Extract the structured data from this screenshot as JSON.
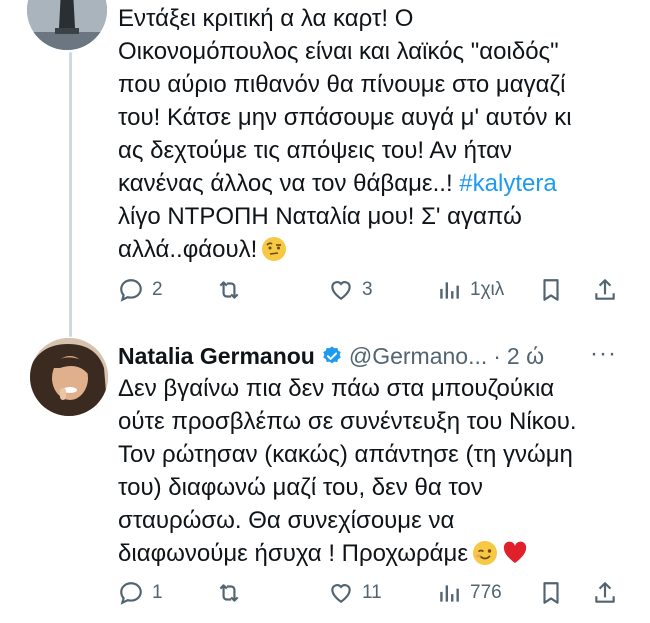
{
  "tweet1": {
    "text_part1": "Εντάξει κριτική α λα καρτ! Ο\nΟικονομόπουλος είναι και λαϊκός \"αοιδός\"\nπου αύριο πιθανόν θα πίνουμε στο μαγαζί\nτου! Κάτσε μην σπάσουμε αυγά μ' αυτόν κι\nας δεχτούμε τις απόψεις του! Αν ήταν\nκανένας άλλος να τον θάβαμε..! ",
    "hashtag": "#kalytera",
    "text_part2": "\nλίγο ΝΤΡΟΠΗ Ναταλία μου! Σ' αγαπώ\nαλλά..φάουλ!",
    "emoji": "raised-eyebrow-emoji",
    "replies": "2",
    "retweets": "",
    "likes": "3",
    "views": "1χιλ"
  },
  "tweet2": {
    "author": "Natalia Germanou",
    "handle": "@Germano...",
    "separator": "·",
    "time": "2 ώ",
    "more": "···",
    "text": "Δεν βγαίνω πια δεν πάω στα μπουζούκια\nούτε προσβλέπω σε συνέντευξη του Νίκου.\nΤον ρώτησαν (κακώς) απάντησε (τη γνώμη\nτου) διαφωνώ μαζί του, δεν θα τον\nσταυρώσω. Θα συνεχίσουμε να\nδιαφωνούμε ήσυχα ! Προχωράμε",
    "emojis": [
      "winking-face-emoji",
      "red-heart-emoji"
    ],
    "replies": "1",
    "retweets": "",
    "likes": "11",
    "views": "776"
  },
  "colors": {
    "text": "#0f1419",
    "muted": "#536471",
    "link": "#1d9bf0",
    "verified": "#1d9bf0",
    "thread_line": "#cfd9de"
  }
}
